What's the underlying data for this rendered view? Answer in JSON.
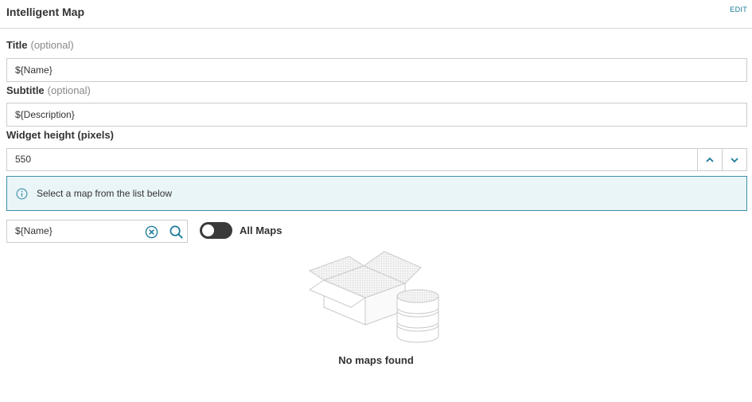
{
  "header": {
    "title": "Intelligent Map",
    "edit_label": "EDIT"
  },
  "title_field": {
    "label": "Title",
    "optional": "(optional)",
    "value": "${Name}"
  },
  "subtitle_field": {
    "label": "Subtitle",
    "optional": "(optional)",
    "value": "${Description}"
  },
  "height_field": {
    "label": "Widget height (pixels)",
    "value": "550"
  },
  "info": {
    "text": "Select a map from the list below",
    "icon": "info-icon"
  },
  "search": {
    "value": "${Name}",
    "clear_icon": "clear-icon",
    "search_icon": "search-icon"
  },
  "toggle": {
    "label": "All Maps",
    "on": false
  },
  "empty": {
    "text": "No maps found",
    "icon": "empty-box-database-illustration"
  },
  "colors": {
    "accent": "#1a7a99",
    "info_border": "#3b8fa8",
    "info_bg": "#eaf5f8",
    "toggle_off": "#3a3a3a"
  }
}
